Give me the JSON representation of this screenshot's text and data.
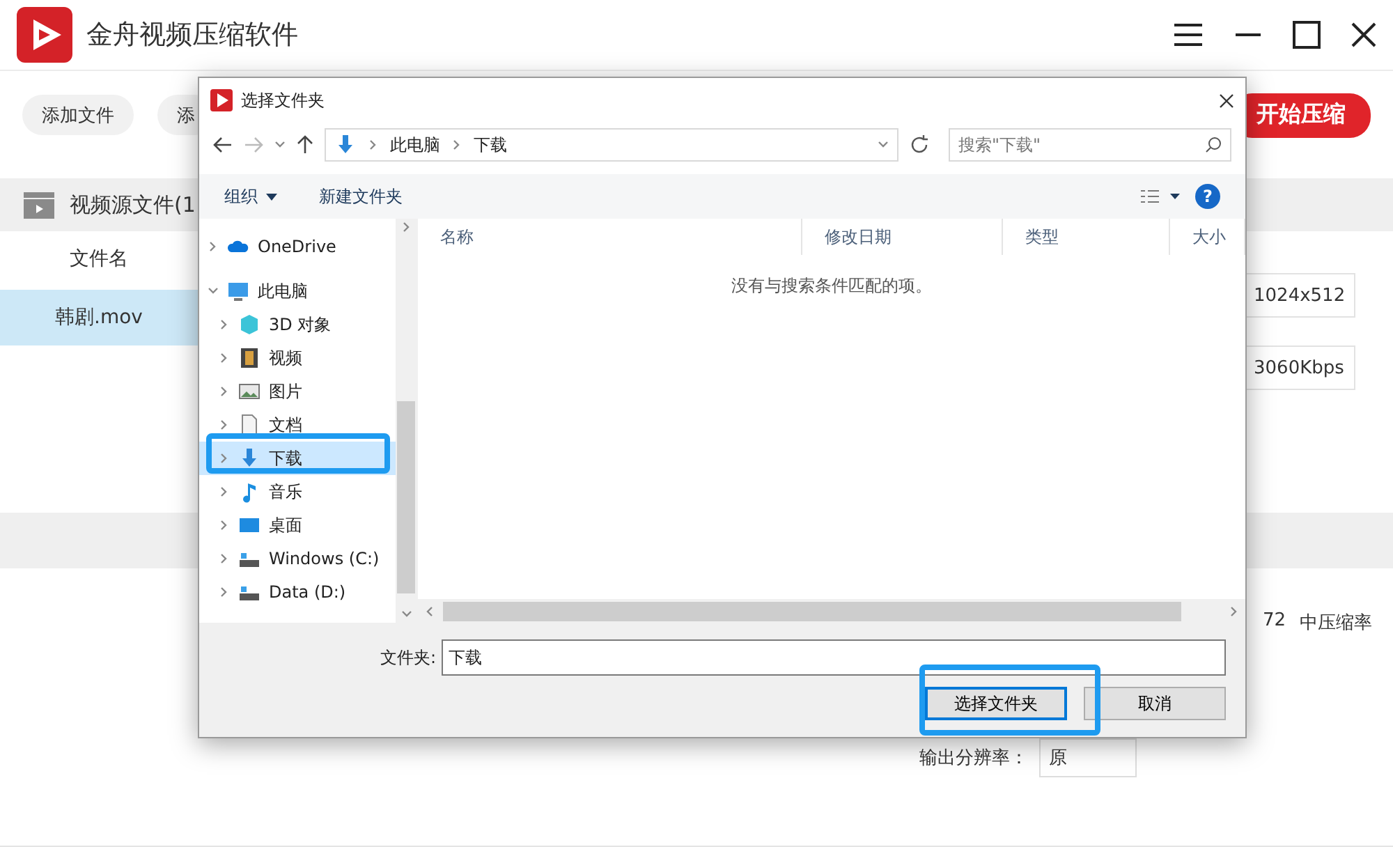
{
  "app": {
    "title": "金舟视频压缩软件",
    "toolbar": [
      {
        "label": "添加文件",
        "kind": "plain"
      },
      {
        "label": "添",
        "kind": "plain"
      },
      {
        "label": "开始压缩",
        "kind": "primary"
      }
    ],
    "section": {
      "title": "视频源文件(1"
    },
    "table": {
      "columns": [
        "文件名"
      ],
      "rows": [
        {
          "name": "韩剧.mov",
          "selected": true
        }
      ]
    },
    "fields": [
      "1024x512",
      "3060Kbps"
    ],
    "compression": {
      "value": "72",
      "label": "中压缩率"
    },
    "resolution": {
      "label": "输出分辨率：",
      "value": "原"
    }
  },
  "dialog": {
    "title": "选择文件夹",
    "path": [
      "此电脑",
      "下载"
    ],
    "search": {
      "placeholder": "搜索\"下载\""
    },
    "help": "?",
    "commands": [
      {
        "label": "组织",
        "kind": "menu"
      },
      {
        "label": "新建文件夹",
        "kind": "plain"
      }
    ],
    "tree": [
      {
        "label": "OneDrive",
        "expanded": false,
        "selected": false
      },
      {
        "label": "此电脑",
        "expanded": true,
        "selected": false,
        "children": [
          {
            "label": "3D 对象",
            "expanded": false,
            "selected": false
          },
          {
            "label": "视频",
            "expanded": false,
            "selected": false
          },
          {
            "label": "图片",
            "expanded": false,
            "selected": false
          },
          {
            "label": "文档",
            "expanded": false,
            "selected": false
          },
          {
            "label": "下载",
            "expanded": false,
            "selected": true
          },
          {
            "label": "音乐",
            "expanded": false,
            "selected": false
          },
          {
            "label": "桌面",
            "expanded": false,
            "selected": false
          },
          {
            "label": "Windows (C:)",
            "expanded": false,
            "selected": false
          },
          {
            "label": "Data (D:)",
            "expanded": false,
            "selected": false
          }
        ]
      }
    ],
    "columns": [
      "名称",
      "修改日期",
      "类型",
      "大小"
    ],
    "empty_message": "没有与搜索条件匹配的项。",
    "folder": {
      "label": "文件夹:",
      "value": "下载"
    },
    "buttons": [
      {
        "label": "选择文件夹",
        "kind": "default"
      },
      {
        "label": "取消",
        "kind": "plain"
      }
    ]
  }
}
